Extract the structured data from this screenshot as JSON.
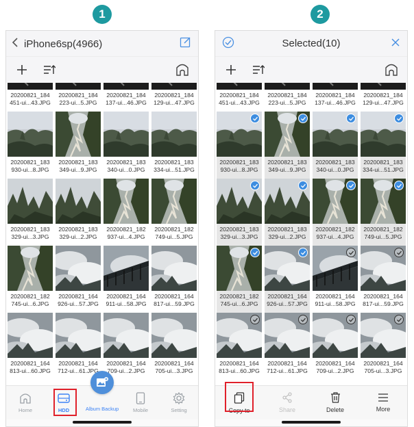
{
  "steps": [
    "1",
    "2"
  ],
  "colors": {
    "accent": "#3b82f6",
    "badge": "#1e9aa0",
    "highlight": "#e0202a",
    "check": "#3d8de0"
  },
  "left": {
    "title": "iPhone6sp(4966)",
    "tabs": [
      {
        "label": "Home",
        "icon": "home-icon"
      },
      {
        "label": "HDD",
        "icon": "hdd-icon",
        "active": true
      },
      {
        "label": "Album Backup",
        "icon": "album-backup-icon"
      },
      {
        "label": "Mobile",
        "icon": "mobile-icon"
      },
      {
        "label": "Setting",
        "icon": "gear-icon"
      }
    ]
  },
  "right": {
    "title": "Selected(10)",
    "actions": [
      {
        "label": "Copy to",
        "icon": "copy-icon"
      },
      {
        "label": "Share",
        "icon": "share-icon",
        "disabled": true
      },
      {
        "label": "Delete",
        "icon": "trash-icon"
      },
      {
        "label": "More",
        "icon": "more-icon"
      }
    ]
  },
  "photos": [
    {
      "l1": "20200821_184",
      "l2": "451-ui...43.JPG",
      "scene": "dark",
      "sel": false
    },
    {
      "l1": "20200821_184",
      "l2": "223-ui...5.JPG",
      "scene": "dark",
      "sel": false
    },
    {
      "l1": "20200821_184",
      "l2": "137-ui...46.JPG",
      "scene": "dark",
      "sel": false
    },
    {
      "l1": "20200821_184",
      "l2": "129-ui...47.JPG",
      "scene": "dark",
      "sel": false
    },
    {
      "l1": "20200821_183",
      "l2": "930-ui...8.JPG",
      "scene": "valley",
      "sel": true
    },
    {
      "l1": "20200821_183",
      "l2": "349-ui...9.JPG",
      "scene": "road",
      "sel": true
    },
    {
      "l1": "20200821_183",
      "l2": "340-ui...0.JPG",
      "scene": "valley",
      "sel": true
    },
    {
      "l1": "20200821_183",
      "l2": "334-ui...51.JPG",
      "scene": "valley",
      "sel": true
    },
    {
      "l1": "20200821_183",
      "l2": "329-ui...3.JPG",
      "scene": "peaks",
      "sel": true
    },
    {
      "l1": "20200821_183",
      "l2": "329-ui...2.JPG",
      "scene": "peaks",
      "sel": true
    },
    {
      "l1": "20200821_182",
      "l2": "937-ui...4.JPG",
      "scene": "road",
      "sel": true
    },
    {
      "l1": "20200821_182",
      "l2": "749-ui...5.JPG",
      "scene": "road",
      "sel": true
    },
    {
      "l1": "20200821_182",
      "l2": "745-ui...6.JPG",
      "scene": "road",
      "sel": true
    },
    {
      "l1": "20200821_164",
      "l2": "926-ui...57.JPG",
      "scene": "cloud",
      "sel": true
    },
    {
      "l1": "20200821_164",
      "l2": "911-ui...58.JPG",
      "scene": "rail",
      "sel": false
    },
    {
      "l1": "20200821_164",
      "l2": "817-ui...59.JPG",
      "scene": "cloud",
      "sel": false
    },
    {
      "l1": "20200821_164",
      "l2": "813-ui...60.JPG",
      "scene": "cloud",
      "sel": false
    },
    {
      "l1": "20200821_164",
      "l2": "712-ui...61.JPG",
      "scene": "cloud",
      "sel": false
    },
    {
      "l1": "20200821_164",
      "l2": "709-ui...2.JPG",
      "scene": "cloud",
      "sel": false
    },
    {
      "l1": "20200821_164",
      "l2": "705-ui...3.JPG",
      "scene": "cloud",
      "sel": false
    }
  ]
}
